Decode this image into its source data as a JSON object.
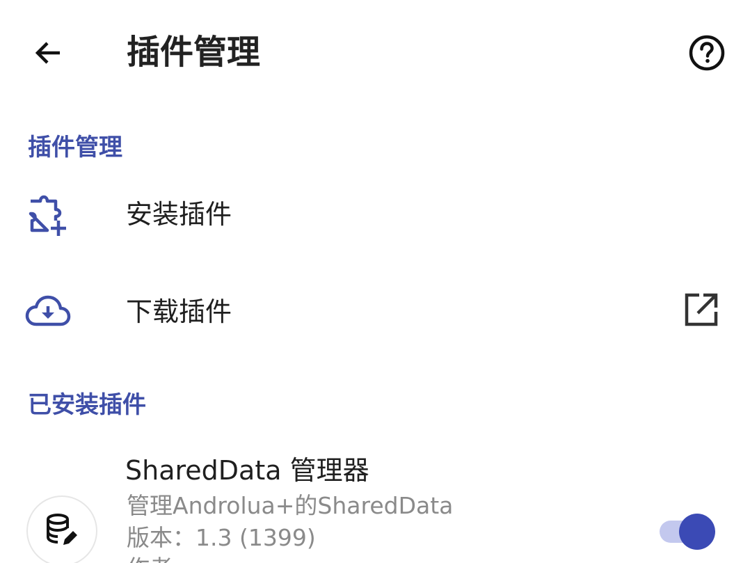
{
  "appbar": {
    "title": "插件管理",
    "back_icon": "arrow-back-icon",
    "help_icon": "help-circle-icon"
  },
  "sections": {
    "management": {
      "header": "插件管理"
    },
    "installed": {
      "header": "已安装插件"
    }
  },
  "management_items": [
    {
      "label": "安装插件",
      "icon": "extension-add-icon"
    },
    {
      "label": "下载插件",
      "icon": "cloud-download-icon",
      "trailing_icon": "open-in-new-icon"
    }
  ],
  "plugin": {
    "title": "SharedData 管理器",
    "description": "管理Androlua+的SharedData",
    "version": "版本：1.3 (1399)",
    "author_partial": "作者",
    "icon": "database-edit-icon",
    "enabled": true
  },
  "colors": {
    "accent": "#3f4fa8",
    "switch_thumb": "#3b4ab5",
    "switch_track": "#c3c8ee",
    "secondary_text": "#8a8a8a"
  }
}
